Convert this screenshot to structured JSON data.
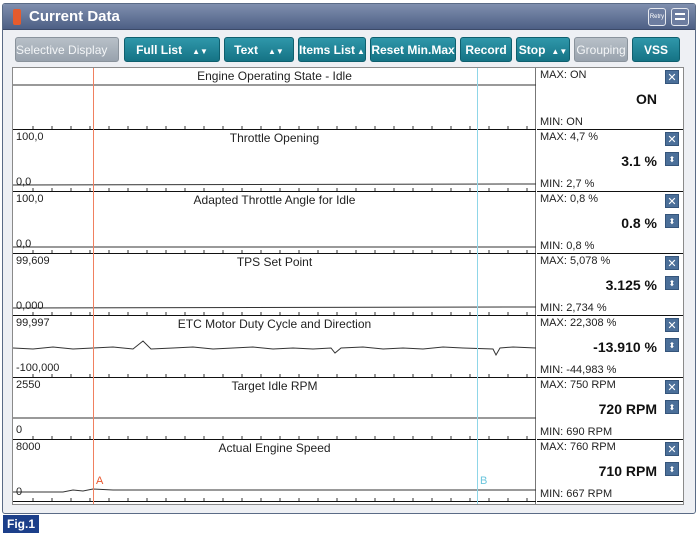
{
  "window": {
    "title": "Current Data",
    "retry_label": "Retry"
  },
  "toolbar": {
    "selective_display": "Selective Display",
    "full_list": "Full List",
    "text": "Text",
    "items_list": "Items List",
    "reset_min_max": "Reset Min.Max",
    "record": "Record",
    "stop": "Stop",
    "grouping": "Grouping",
    "vss": "VSS"
  },
  "markers": {
    "a": "A",
    "b": "B"
  },
  "colors": {
    "accent": "#1a7f92",
    "marker_a": "#f08060",
    "marker_b": "#8fd6e8",
    "close_button": "#4b6f99",
    "fig_label": "#1c3f8a"
  },
  "icons": {
    "title": "orange-bar-icon",
    "retry": "retry-icon",
    "menu": "menu-icon",
    "close": "close-icon",
    "sort": "sort-arrows-icon",
    "dropdown": "up-down-arrow-icon"
  },
  "graphs": [
    {
      "title": "Engine Operating State - Idle",
      "ymax": "",
      "ymin": "",
      "max": "MAX: ON",
      "current": "ON",
      "min": "MIN: ON",
      "has_sort": false
    },
    {
      "title": "Throttle Opening",
      "ymax": "100,0",
      "ymin": "0,0",
      "max": "MAX:   4,7 %",
      "current": "3.1 %",
      "min": "MIN:   2,7 %",
      "has_sort": true
    },
    {
      "title": "Adapted Throttle Angle for Idle",
      "ymax": "100,0",
      "ymin": "0,0",
      "max": "MAX:   0,8 %",
      "current": "0.8 %",
      "min": "MIN:   0,8 %",
      "has_sort": true
    },
    {
      "title": "TPS Set Point",
      "ymax": "99,609",
      "ymin": "0,000",
      "max": "MAX: 5,078 %",
      "current": "3.125 %",
      "min": "MIN: 2,734 %",
      "has_sort": true
    },
    {
      "title": "ETC Motor Duty Cycle and Direction",
      "ymax": "99,997",
      "ymin": "-100,000",
      "max": "MAX: 22,308 %",
      "current": "-13.910 %",
      "min": "MIN: -44,983 %",
      "has_sort": true
    },
    {
      "title": "Target Idle RPM",
      "ymax": "2550",
      "ymin": "0",
      "max": "MAX:    750 RPM",
      "current": "720 RPM",
      "min": "MIN:    690 RPM",
      "has_sort": true
    },
    {
      "title": "Actual Engine Speed",
      "ymax": "8000",
      "ymin": "0",
      "max": "MAX:    760 RPM",
      "current": "710 RPM",
      "min": "MIN:    667 RPM",
      "has_sort": true
    }
  ],
  "figure": {
    "label": "Fig.1"
  }
}
